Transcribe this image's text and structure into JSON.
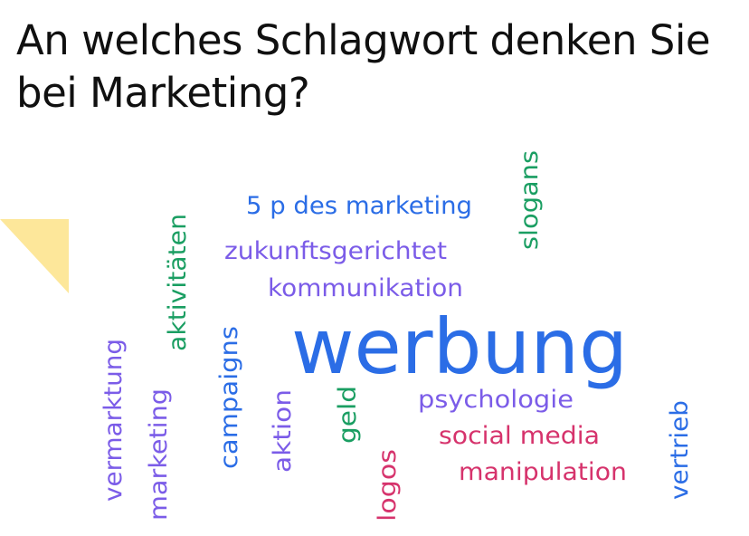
{
  "title": "An welches Schlagwort denken Sie bei Marketing?",
  "colors": {
    "blue": "#2b6de6",
    "violet": "#7b5ce8",
    "green": "#1a9e62",
    "pink": "#d6336c",
    "yellow_accent": "#fde79a"
  },
  "cloud": {
    "werbung": "werbung",
    "des_marketing": "5 p des marketing",
    "zukunftsgerichtet": "zukunftsgerichtet",
    "kommunikation": "kommunikation",
    "slogans": "slogans",
    "aktivitaeten": "aktivitäten",
    "vermarktung": "vermarktung",
    "marketing": "marketing",
    "campaigns": "campaigns",
    "aktion": "aktion",
    "geld": "geld",
    "logos": "logos",
    "psychologie": "psychologie",
    "social_media": "social media",
    "manipulation": "manipulation",
    "vertrieb": "vertrieb"
  }
}
